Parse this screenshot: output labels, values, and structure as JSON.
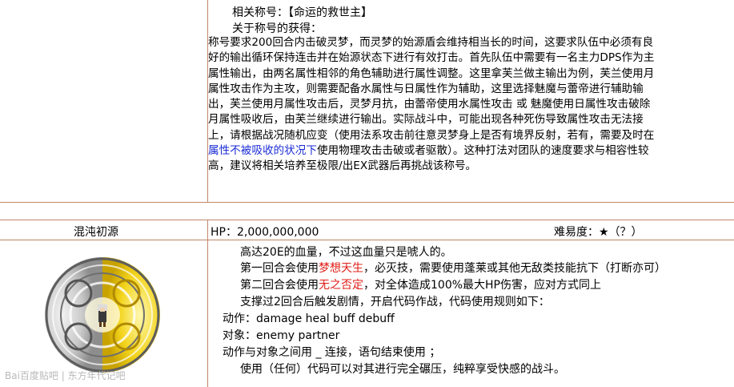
{
  "section1": {
    "title_prefix": "相关称号：",
    "title_value": "【命运的救世主】",
    "obtain_heading": "关于称号的获得：",
    "lines": [
      " 称号要求200回合内击破灵梦，而灵梦的始源盾会维持相当长的时间，这要求队伍中必须有良",
      "好的输出循环保持连击并在始源状态下进行有效打击。首先队伍中需要有一名主力DPS作为主",
      "属性输出，由两名属性相邻的角色辅助进行属性调整。这里拿芙兰做主输出为例，芙兰使用月",
      "属性攻击作为主攻，则需要配备水属性与日属性作为辅助，这里选择魅魔与蕾帝进行辅助输",
      "出，芙兰使用月属性攻击后，灵梦月抗，由蕾帝使用水属性攻击 或 魅魔使用日属性攻击破除",
      "月属性吸收后，由芙兰继续进行输出。实际战斗中，可能出现各种死伤导致属性攻击无法接",
      "上，请根据战况随机应变（使用法系攻击前往意灵梦身上是否有境界反射，若有，需要及时在"
    ],
    "line8_blue": "属性不被吸收的状况下",
    "line8_rest": "使用物理攻击击破或者驱散）。这种打法对团队的速度要求与相容性较",
    "line9": "高，建议将相关培养至极限/出EX武器后再挑战该称号。"
  },
  "section2": {
    "name": "混沌初源",
    "hp_label": "HP：2,000,000,000",
    "difficulty_label": "难易度：",
    "difficulty_stars": "★（？）",
    "line1": "高达20E的血量，不过这血量只是唬人的。",
    "line2_a": "第一回合会使用",
    "line2_red": "梦想天生",
    "line2_b": "，必灭技，需要使用蓬莱或其他无敌类技能抗下（打断亦可）",
    "line3_a": "第二回合会使用",
    "line3_red": "无之否定",
    "line3_b": "，对全体造成100%最大HP伤害，应对方式同上",
    "line4": "支撑过2回合后触发剧情，开启代码作战，代码使用规则如下：",
    "line5": "动作：damage heal buff debuff",
    "line6": "对象：enemy partner",
    "line7": "动作与对象之间用 _ 连接，语句结束使用 ；",
    "line8": "使用（任何）代码可以对其进行完全碾压，纯粹享受快感的战斗。"
  },
  "watermark": "Bai百度贴吧 | 东方年代记吧",
  "colors": {
    "border": "#c1856a",
    "highlight_blue": "#1a2bd6",
    "highlight_red": "#e0201a"
  }
}
